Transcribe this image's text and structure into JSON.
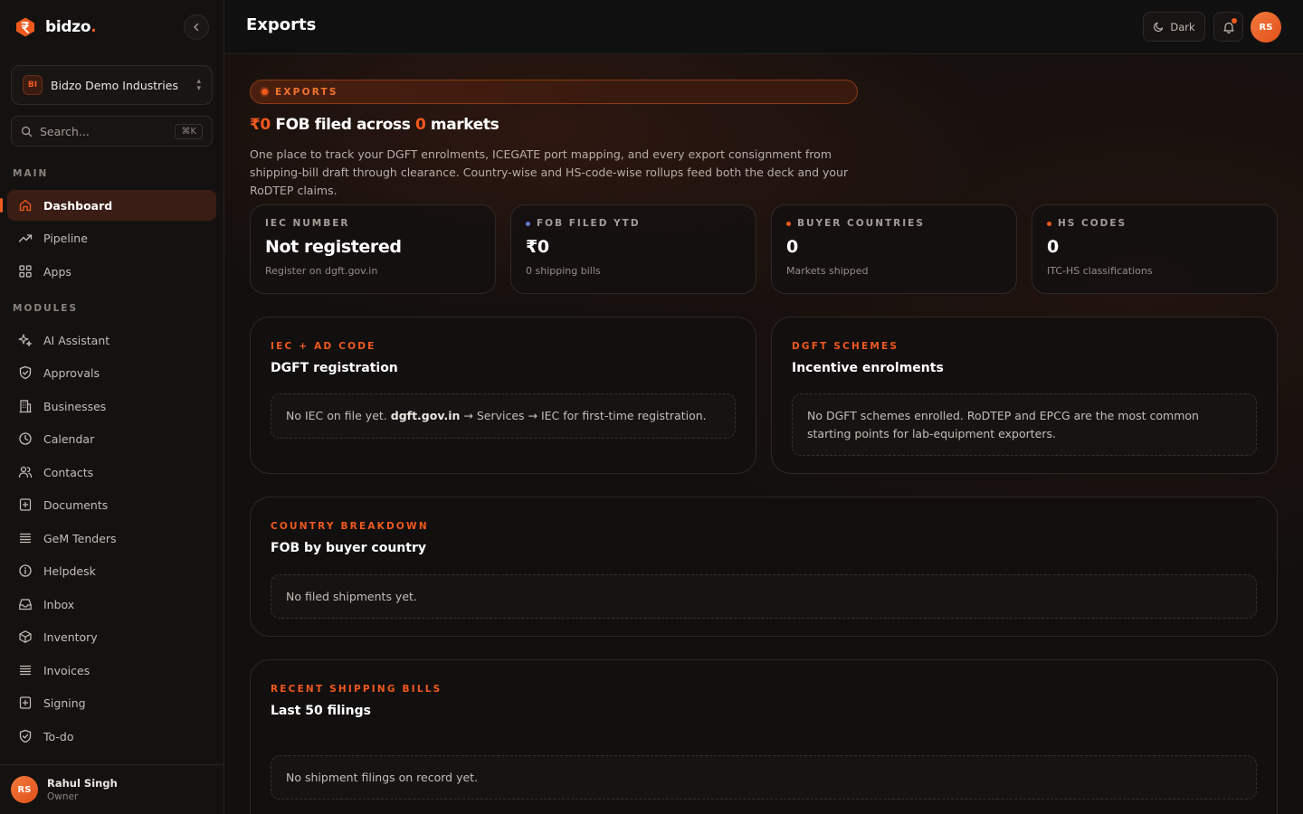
{
  "brand": {
    "name": "bidzo",
    "dot": "."
  },
  "org": {
    "badge": "BI",
    "name": "Bidzo Demo Industries"
  },
  "search": {
    "placeholder": "Search...",
    "shortcut": "⌘K"
  },
  "sidebar": {
    "main_label": "MAIN",
    "main_items": [
      {
        "label": "Dashboard",
        "icon": "home-icon",
        "active": true
      },
      {
        "label": "Pipeline",
        "icon": "trending-up-icon"
      },
      {
        "label": "Apps",
        "icon": "grid-icon"
      }
    ],
    "modules_label": "MODULES",
    "module_items": [
      {
        "label": "AI Assistant",
        "icon": "sparkles-icon"
      },
      {
        "label": "Approvals",
        "icon": "shield-check-icon"
      },
      {
        "label": "Businesses",
        "icon": "building-icon"
      },
      {
        "label": "Calendar",
        "icon": "clock-icon"
      },
      {
        "label": "Contacts",
        "icon": "users-icon"
      },
      {
        "label": "Documents",
        "icon": "file-plus-icon"
      },
      {
        "label": "GeM Tenders",
        "icon": "list-icon"
      },
      {
        "label": "Helpdesk",
        "icon": "info-icon"
      },
      {
        "label": "Inbox",
        "icon": "inbox-icon"
      },
      {
        "label": "Inventory",
        "icon": "package-icon"
      },
      {
        "label": "Invoices",
        "icon": "list-icon"
      },
      {
        "label": "Signing",
        "icon": "file-plus-icon"
      },
      {
        "label": "To-do",
        "icon": "shield-check-icon"
      }
    ]
  },
  "user": {
    "initials": "RS",
    "name": "Rahul Singh",
    "role": "Owner"
  },
  "topbar": {
    "title": "Exports",
    "theme_label": "Dark",
    "avatar_initials": "RS"
  },
  "hero": {
    "eyebrow": "EXPORTS",
    "amount": "₹0",
    "title_mid": " FOB filed across ",
    "count": "0",
    "title_end": " markets",
    "description": "One place to track your DGFT enrolments, ICEGATE port mapping, and every export consignment from shipping-bill draft through clearance. Country-wise and HS-code-wise rollups feed both the deck and your RoDTEP claims."
  },
  "stats": [
    {
      "label": "IEC NUMBER",
      "value": "Not registered",
      "sub": "Register on dgft.gov.in",
      "dot": ""
    },
    {
      "label": "FOB FILED YTD",
      "value": "₹0",
      "sub": "0 shipping bills",
      "dot": "#5b7bd5"
    },
    {
      "label": "BUYER COUNTRIES",
      "value": "0",
      "sub": "Markets shipped",
      "dot": "#f0591e"
    },
    {
      "label": "HS CODES",
      "value": "0",
      "sub": "ITC-HS classifications",
      "dot": "#f0591e"
    }
  ],
  "panels": {
    "iec": {
      "eyebrow": "IEC + AD CODE",
      "title": "DGFT registration",
      "empty_pre": "No IEC on file yet. ",
      "empty_link": "dgft.gov.in",
      "empty_post": " → Services → IEC for first-time registration."
    },
    "schemes": {
      "eyebrow": "DGFT SCHEMES",
      "title": "Incentive enrolments",
      "empty": "No DGFT schemes enrolled. RoDTEP and EPCG are the most common starting points for lab-equipment exporters."
    },
    "country": {
      "eyebrow": "COUNTRY BREAKDOWN",
      "title": "FOB by buyer country",
      "empty": "No filed shipments yet."
    },
    "bills": {
      "eyebrow": "RECENT SHIPPING BILLS",
      "title": "Last 50 filings",
      "empty": "No shipment filings on record yet."
    }
  },
  "colors": {
    "accent": "#f0591e",
    "background": "#120f0e",
    "sidebar": "#141211"
  }
}
